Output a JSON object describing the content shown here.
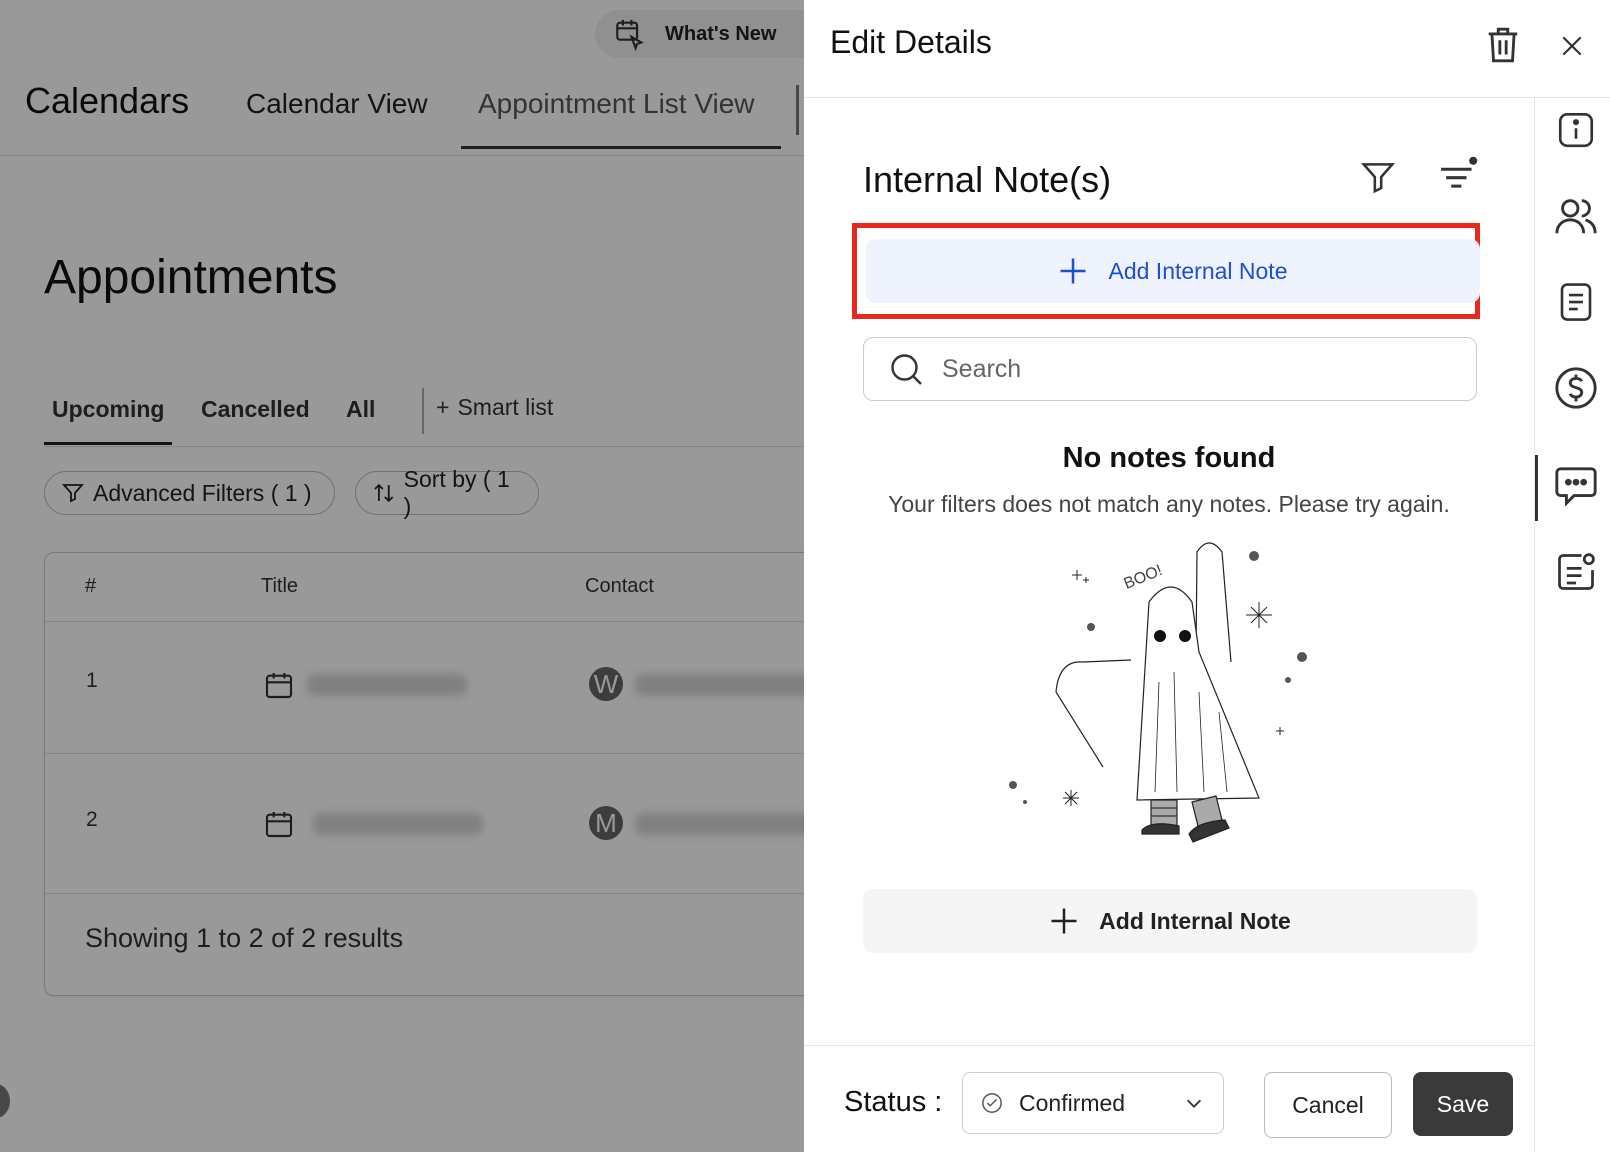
{
  "background": {
    "whats_new": "What's New",
    "app_title": "Calendars",
    "nav_tabs": [
      "Calendar View",
      "Appointment List View"
    ],
    "page_title": "Appointments",
    "sub_tabs": [
      "Upcoming",
      "Cancelled",
      "All"
    ],
    "smart_list": "Smart list",
    "filters_label": "Advanced Filters ( 1 )",
    "sort_label": "Sort by ( 1 )",
    "table": {
      "headers": [
        "#",
        "Title",
        "Contact"
      ],
      "rows": [
        {
          "num": "1",
          "avatar": "W"
        },
        {
          "num": "2",
          "avatar": "M"
        }
      ]
    },
    "results_text": "Showing 1 to 2 of 2 results"
  },
  "drawer": {
    "title": "Edit Details",
    "notes_title": "Internal Note(s)",
    "add_note_label": "Add Internal Note",
    "search_placeholder": "Search",
    "empty_title": "No notes found",
    "empty_subtitle": "Your filters does not match any notes. Please try again.",
    "illustration_text": "BOO!",
    "bottom_add_note_label": "Add Internal Note",
    "footer": {
      "status_label": "Status :",
      "status_value": "Confirmed",
      "cancel_label": "Cancel",
      "save_label": "Save"
    },
    "rail_icons": [
      "info-icon",
      "people-icon",
      "document-icon",
      "dollar-icon",
      "chat-icon",
      "note-icon"
    ]
  },
  "colors": {
    "highlight": "#e8281f",
    "primary_text": "#1d4ed8",
    "save_bg": "#3a3a3a"
  }
}
